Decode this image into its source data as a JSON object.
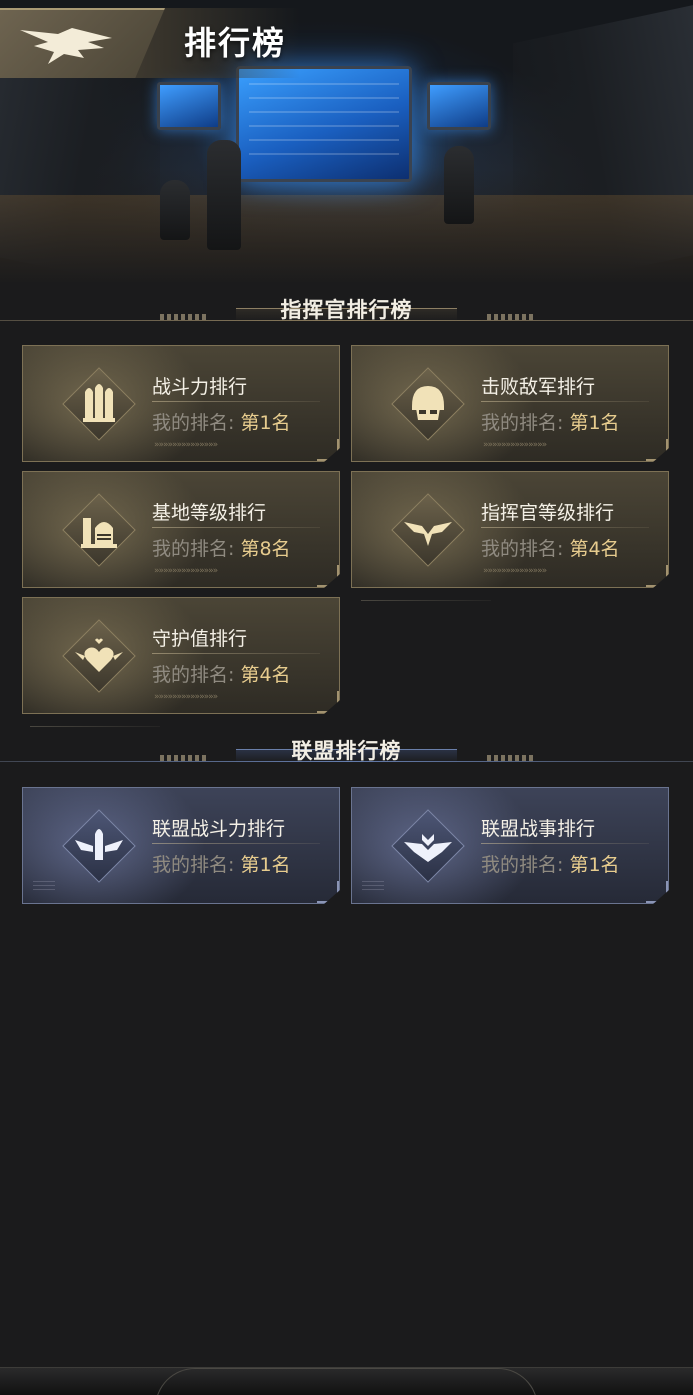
{
  "header": {
    "title": "排行榜",
    "back_icon": "eagle-emblem-icon"
  },
  "commander_section": {
    "title": "指挥官排行榜",
    "cards": [
      {
        "title": "战斗力排行",
        "rank_prefix": "我的排名: ",
        "rank_value": "第1名",
        "icon": "bullets-icon"
      },
      {
        "title": "击败敌军排行",
        "rank_prefix": "我的排名: ",
        "rank_value": "第1名",
        "icon": "helmet-skull-icon"
      },
      {
        "title": "基地等级排行",
        "rank_prefix": "我的排名: ",
        "rank_value": "第8名",
        "icon": "base-building-icon"
      },
      {
        "title": "指挥官等级排行",
        "rank_prefix": "我的排名: ",
        "rank_value": "第4名",
        "icon": "winged-chevron-icon"
      },
      {
        "title": "守护值排行",
        "rank_prefix": "我的排名: ",
        "rank_value": "第4名",
        "icon": "winged-heart-icon"
      }
    ]
  },
  "alliance_section": {
    "title": "联盟排行榜",
    "cards": [
      {
        "title": "联盟战斗力排行",
        "rank_prefix": "我的排名: ",
        "rank_value": "第1名",
        "icon": "winged-bullet-icon"
      },
      {
        "title": "联盟战事排行",
        "rank_prefix": "我的排名: ",
        "rank_value": "第1名",
        "icon": "winged-badge-icon"
      }
    ]
  },
  "decor": {
    "chevrons": "»»»»»»»»»»»»»»"
  },
  "colors": {
    "gold_accent": "#e7cc8e",
    "background": "#1b1b1c",
    "commander_card": "#4b4536",
    "alliance_card": "#3d4358"
  }
}
